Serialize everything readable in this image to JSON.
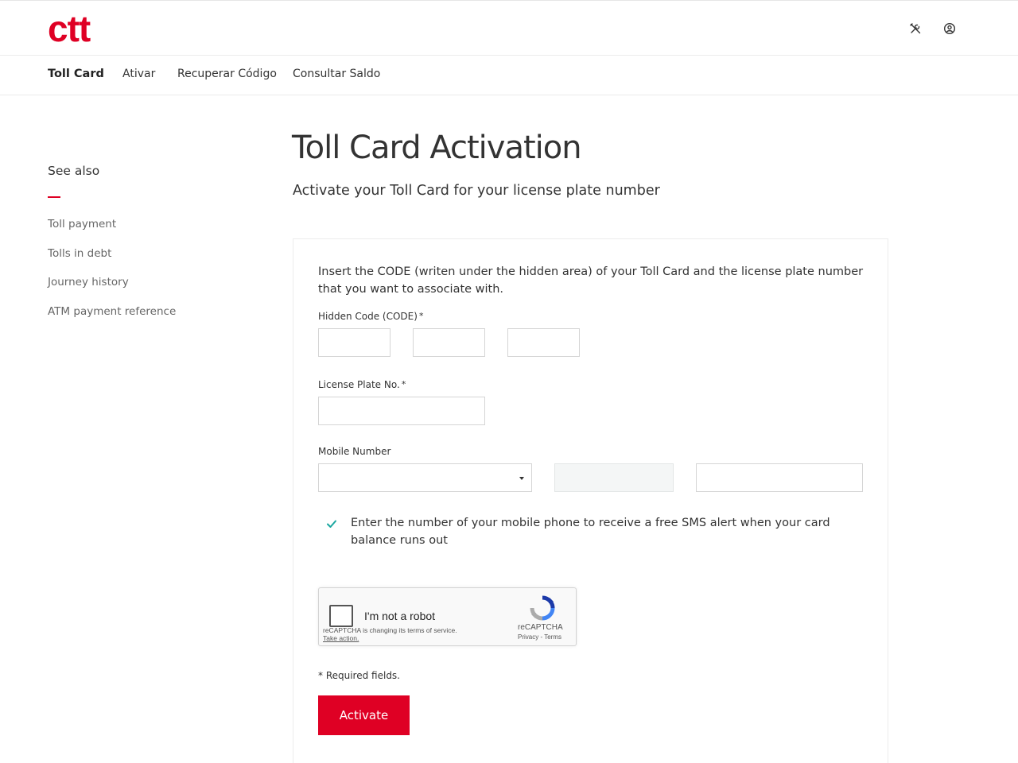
{
  "header": {
    "logo_text": "ctt",
    "brand_color": "#df0024",
    "icons": [
      "tools-icon",
      "user-account-icon"
    ]
  },
  "nav": {
    "items": [
      {
        "label": "Toll Card",
        "active": true
      },
      {
        "label": "Ativar"
      },
      {
        "label": "Recuperar Código"
      },
      {
        "label": "Consultar Saldo"
      }
    ]
  },
  "sidebar": {
    "title": "See also",
    "links": [
      {
        "label": "Toll payment"
      },
      {
        "label": "Tolls in debt"
      },
      {
        "label": "Journey history"
      },
      {
        "label": "ATM payment reference"
      }
    ]
  },
  "main": {
    "title": "Toll Card Activation",
    "subtitle": "Activate your Toll Card for your license plate number"
  },
  "form": {
    "intro": "Insert the CODE (writen under the hidden area) of your Toll Card and the license plate number that you want to associate with.",
    "hidden_code": {
      "label": "Hidden Code (CODE)",
      "required_mark": "*",
      "values": [
        "",
        "",
        ""
      ]
    },
    "license_plate": {
      "label": "License Plate No.",
      "required_mark": "*",
      "value": ""
    },
    "mobile": {
      "label": "Mobile Number",
      "country_selected": "",
      "prefix": "",
      "number": ""
    },
    "hint": "Enter the number of your mobile phone to receive a free SMS alert when your card balance runs out",
    "hint_icon": "checkmark-icon",
    "hint_color": "#1aa7a0",
    "required_note": "* Required fields.",
    "submit_label": "Activate"
  },
  "captcha": {
    "label": "I'm not a robot",
    "note": "reCAPTCHA is changing its terms of service.",
    "action": "Take action.",
    "brand": "reCAPTCHA",
    "privacy": "Privacy",
    "separator": " - ",
    "terms": "Terms"
  }
}
